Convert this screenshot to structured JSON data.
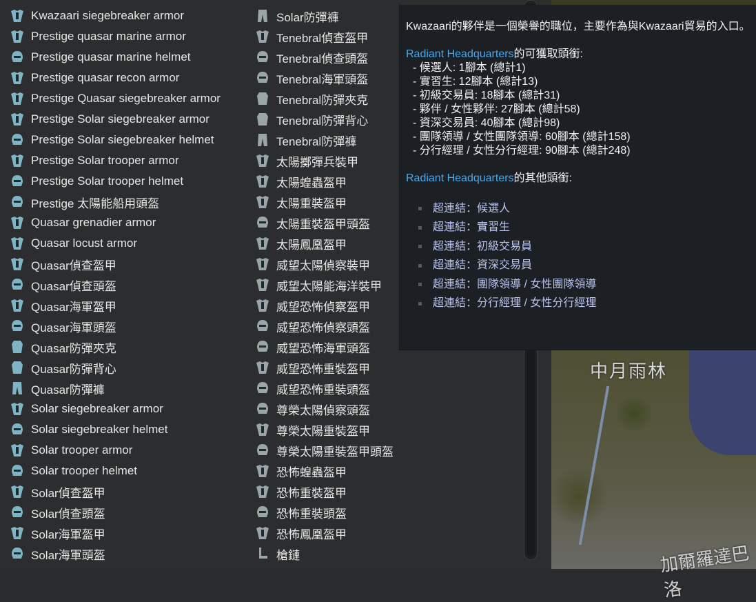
{
  "colors": {
    "link": "#4aa8e8",
    "hyperlink": "#b9c3ef",
    "icon": "#7fb3c6"
  },
  "list_col1": [
    {
      "label": "Kwazaari siegebreaker armor",
      "icon": "siegebreaker-armor-icon"
    },
    {
      "label": "Prestige quasar marine armor",
      "icon": "marine-armor-icon"
    },
    {
      "label": "Prestige quasar marine helmet",
      "icon": "marine-helmet-icon"
    },
    {
      "label": "Prestige quasar recon armor",
      "icon": "recon-armor-icon"
    },
    {
      "label": "Prestige Quasar siegebreaker armor",
      "icon": "siegebreaker-armor-icon"
    },
    {
      "label": "Prestige Solar siegebreaker armor",
      "icon": "siegebreaker-armor-icon"
    },
    {
      "label": "Prestige Solar siegebreaker helmet",
      "icon": "siegebreaker-helmet-icon"
    },
    {
      "label": "Prestige Solar trooper armor",
      "icon": "trooper-armor-icon"
    },
    {
      "label": "Prestige Solar trooper helmet",
      "icon": "trooper-helmet-icon"
    },
    {
      "label": "Prestige 太陽能船用頭盔",
      "icon": "marine-helmet-icon"
    },
    {
      "label": "Quasar grenadier armor",
      "icon": "grenadier-armor-icon"
    },
    {
      "label": "Quasar locust armor",
      "icon": "locust-armor-icon"
    },
    {
      "label": "Quasar偵查盔甲",
      "icon": "recon-armor-icon"
    },
    {
      "label": "Quasar偵查頭盔",
      "icon": "recon-helmet-icon"
    },
    {
      "label": "Quasar海軍盔甲",
      "icon": "marine-armor-icon"
    },
    {
      "label": "Quasar海軍頭盔",
      "icon": "marine-helmet-icon"
    },
    {
      "label": "Quasar防彈夾克",
      "icon": "flak-jacket-icon"
    },
    {
      "label": "Quasar防彈背心",
      "icon": "flak-vest-icon"
    },
    {
      "label": "Quasar防彈褲",
      "icon": "flak-pants-icon"
    },
    {
      "label": "Solar siegebreaker armor",
      "icon": "siegebreaker-armor-icon"
    },
    {
      "label": "Solar siegebreaker helmet",
      "icon": "siegebreaker-helmet-icon"
    },
    {
      "label": "Solar trooper armor",
      "icon": "trooper-armor-icon"
    },
    {
      "label": "Solar trooper helmet",
      "icon": "trooper-helmet-icon"
    },
    {
      "label": "Solar偵查盔甲",
      "icon": "recon-armor-icon"
    },
    {
      "label": "Solar偵查頭盔",
      "icon": "recon-helmet-icon"
    },
    {
      "label": "Solar海軍盔甲",
      "icon": "marine-armor-icon"
    },
    {
      "label": "Solar海軍頭盔",
      "icon": "marine-helmet-icon"
    }
  ],
  "list_col2": [
    {
      "label": "Solar防彈褲",
      "icon": "flak-pants-icon"
    },
    {
      "label": "Tenebral偵查盔甲",
      "icon": "recon-armor-icon"
    },
    {
      "label": "Tenebral偵查頭盔",
      "icon": "recon-helmet-icon"
    },
    {
      "label": "Tenebral海軍頭盔",
      "icon": "marine-helmet-icon"
    },
    {
      "label": "Tenebral防彈夾克",
      "icon": "flak-jacket-icon"
    },
    {
      "label": "Tenebral防彈背心",
      "icon": "flak-vest-icon"
    },
    {
      "label": "Tenebral防彈褲",
      "icon": "flak-pants-icon"
    },
    {
      "label": "太陽擲彈兵裝甲",
      "icon": "grenadier-armor-icon"
    },
    {
      "label": "太陽蝗蟲盔甲",
      "icon": "locust-armor-icon"
    },
    {
      "label": "太陽重裝盔甲",
      "icon": "cataphract-armor-icon"
    },
    {
      "label": "太陽重裝盔甲頭盔",
      "icon": "cataphract-helmet-icon"
    },
    {
      "label": "太陽鳳凰盔甲",
      "icon": "phoenix-armor-icon"
    },
    {
      "label": "威望太陽偵察裝甲",
      "icon": "recon-armor-icon"
    },
    {
      "label": "威望太陽能海洋裝甲",
      "icon": "marine-armor-icon"
    },
    {
      "label": "威望恐怖偵察盔甲",
      "icon": "recon-armor-icon"
    },
    {
      "label": "威望恐怖偵察頭盔",
      "icon": "recon-helmet-icon"
    },
    {
      "label": "威望恐怖海軍頭盔",
      "icon": "marine-helmet-icon"
    },
    {
      "label": "威望恐怖重裝盔甲",
      "icon": "cataphract-armor-icon"
    },
    {
      "label": "威望恐怖重裝頭盔",
      "icon": "cataphract-helmet-icon"
    },
    {
      "label": "尊榮太陽偵察頭盔",
      "icon": "recon-helmet-icon"
    },
    {
      "label": "尊榮太陽重裝盔甲",
      "icon": "cataphract-armor-icon"
    },
    {
      "label": "尊榮太陽重裝盔甲頭盔",
      "icon": "cataphract-helmet-icon"
    },
    {
      "label": "恐怖蝗蟲盔甲",
      "icon": "locust-armor-icon"
    },
    {
      "label": "恐怖重裝盔甲",
      "icon": "cataphract-armor-icon"
    },
    {
      "label": "恐怖重裝頭盔",
      "icon": "cataphract-helmet-icon"
    },
    {
      "label": "恐怖鳳凰盔甲",
      "icon": "phoenix-armor-icon"
    },
    {
      "label": "槍鏈",
      "icon": "gun-link-icon"
    }
  ],
  "tooltip": {
    "intro": "Kwazaari的夥伴是一個榮譽的職位，主要作為與Kwazaari貿易的入口。",
    "faction_link": "Radiant Headquarters",
    "obtainable_suffix": "的可獲取頭銜:",
    "ranks": [
      "- 候選人: 1腳本 (總計1)",
      "- 實習生: 12腳本 (總計13)",
      "- 初級交易員: 18腳本 (總計31)",
      "- 夥伴 / 女性夥伴: 27腳本 (總計58)",
      "- 資深交易員: 40腳本 (總計98)",
      "- 團隊領導 / 女性團隊領導: 60腳本 (總計158)",
      "- 分行經理 / 女性分行經理: 90腳本 (總計248)"
    ],
    "faction_link_2": "Radiant Headquarters",
    "other_suffix": "的其他頭銜:",
    "hyperlinks": [
      "超連結：候選人",
      "超連結：實習生",
      "超連結：初級交易員",
      "超連結：資深交易員",
      "超連結：團隊領導 / 女性團隊領導",
      "超連結：分行經理 / 女性分行經理"
    ]
  },
  "map": {
    "label_1": "中月雨林",
    "label_2": "加爾羅達巴洛"
  }
}
